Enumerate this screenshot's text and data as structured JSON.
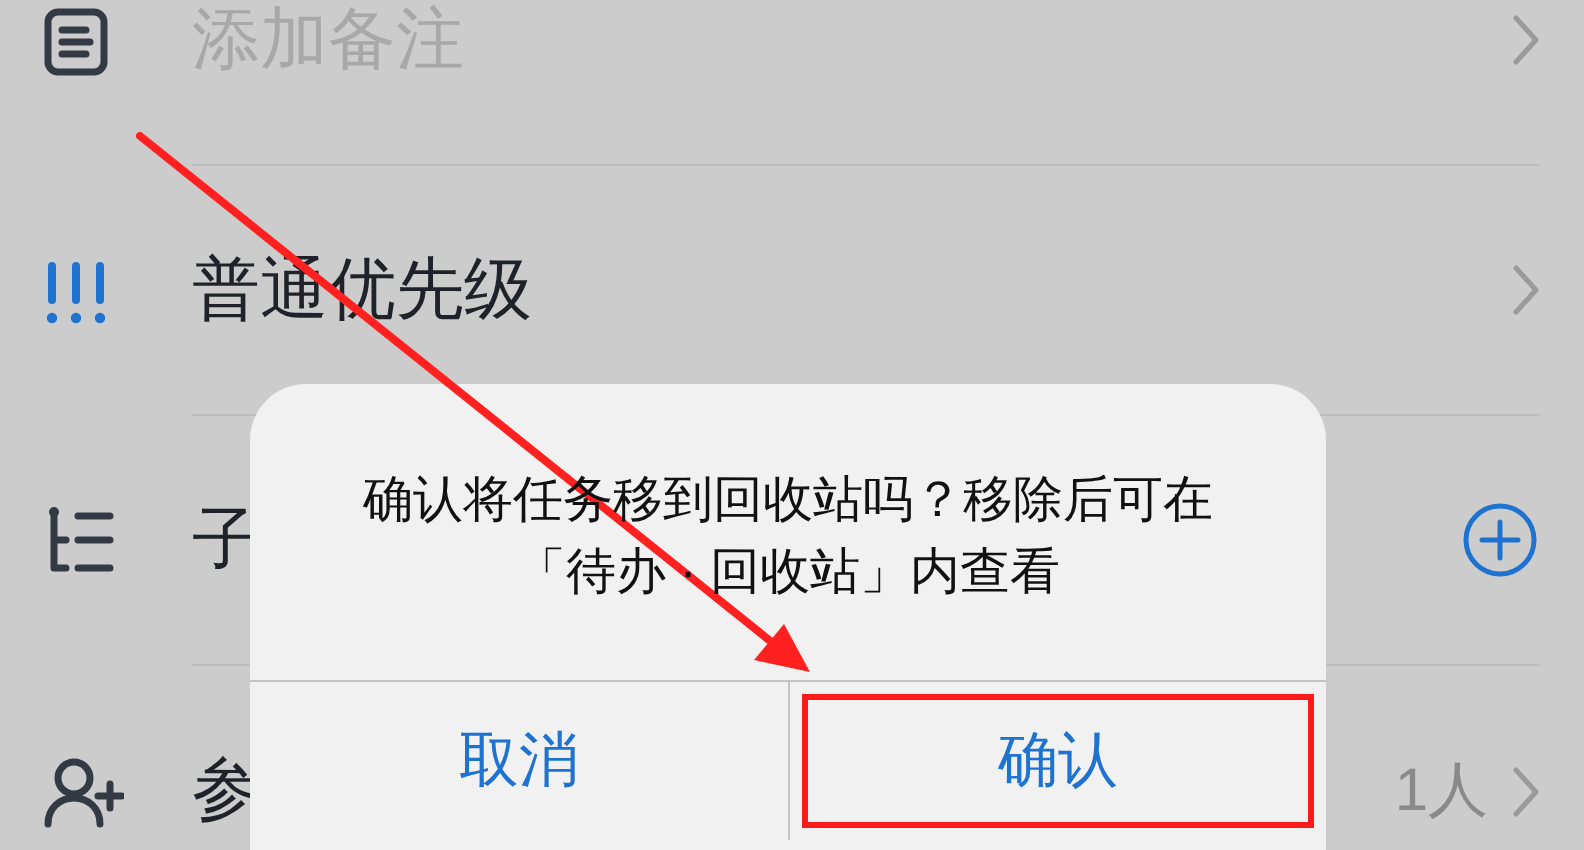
{
  "rows": [
    {
      "kind": "note",
      "placeholder": "添加备注"
    },
    {
      "kind": "priority",
      "label": "普通优先级"
    },
    {
      "kind": "subtask",
      "label": "子"
    },
    {
      "kind": "assignee",
      "label": "参",
      "value": "1人"
    }
  ],
  "dialog": {
    "message_lines": [
      "确认将任务移到回收站吗？移除后可在",
      "「待办 · 回收站」内查看"
    ],
    "buttons": [
      {
        "label": "取消",
        "highlighted": false
      },
      {
        "label": "确认",
        "highlighted": true
      }
    ]
  },
  "annotations": [
    {
      "kind": "arrow"
    }
  ]
}
